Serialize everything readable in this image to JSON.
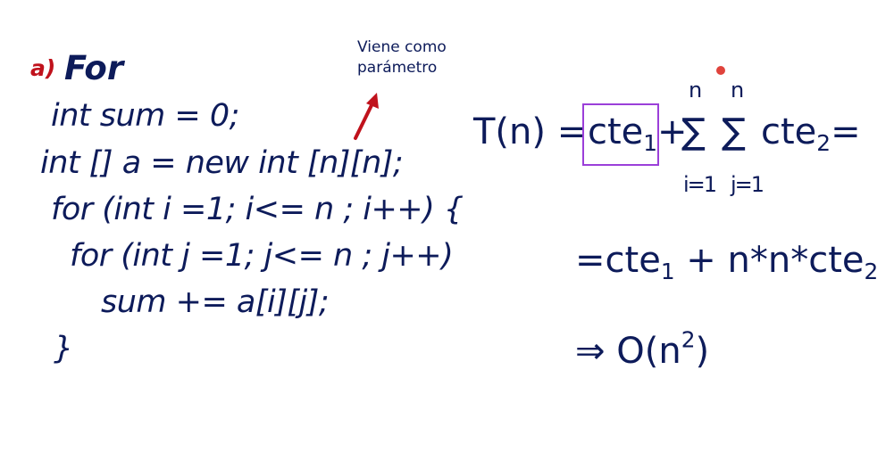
{
  "heading": {
    "label": "a)",
    "title": "For"
  },
  "annotation": {
    "line1": "Viene como",
    "line2": "parámetro"
  },
  "code_lines": [
    "int sum = 0;",
    "int [] a = new int [n][n];",
    "for (int i =1; i<= n ; i++) {",
    "for (int j =1; j<= n ; j++)",
    "sum += a[i][j];",
    "}"
  ],
  "formula": {
    "lhs": "T(n) =",
    "boxed_term": "cte",
    "boxed_sub": "1",
    "plus": "+",
    "sigma": "∑",
    "upper_i": "n",
    "upper_j": "n",
    "lower_i": "i=1",
    "lower_j": "j=1",
    "term2": "cte",
    "term2_sub": "2",
    "trailing_eq": "="
  },
  "step2": {
    "eq": "=",
    "t1": "cte",
    "t1_sub": "1",
    "rest": " + n*n*cte",
    "rest_sub": "2"
  },
  "step3": {
    "arrow": "⇒",
    "big_o": "O(n",
    "exp": "2",
    "close": ")"
  },
  "colors": {
    "text": "#0d1b5a",
    "accent_red": "#c0121c",
    "box": "#9b3fd9",
    "dot": "#e0433c"
  }
}
